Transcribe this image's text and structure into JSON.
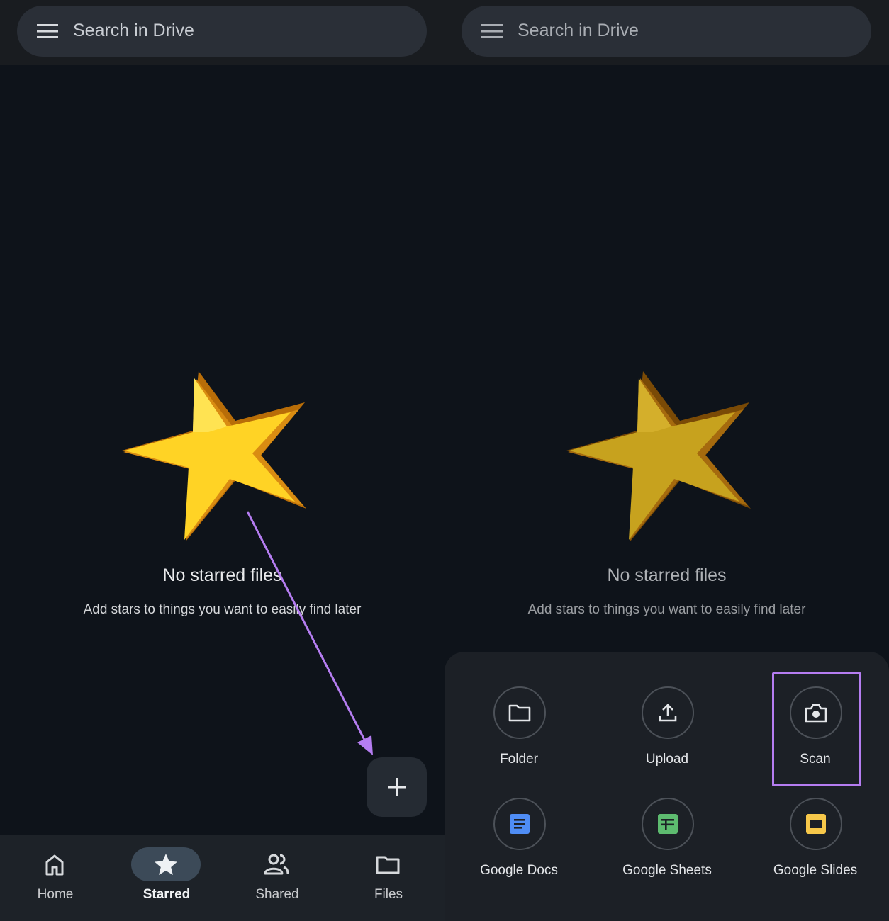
{
  "left_panel": {
    "search": {
      "placeholder": "Search in Drive",
      "icon": "menu-icon"
    },
    "empty_state": {
      "title": "No starred files",
      "subtitle": "Add stars to things you want to easily find later",
      "illustration": "star-illustration"
    },
    "fab": {
      "icon": "plus-icon"
    },
    "bottom_nav": [
      {
        "label": "Home",
        "icon": "home-icon",
        "active": false
      },
      {
        "label": "Starred",
        "icon": "star-icon",
        "active": true
      },
      {
        "label": "Shared",
        "icon": "people-icon",
        "active": false
      },
      {
        "label": "Files",
        "icon": "folder-icon",
        "active": false
      }
    ]
  },
  "right_panel": {
    "search": {
      "placeholder": "Search in Drive",
      "icon": "menu-icon"
    },
    "empty_state": {
      "title": "No starred files",
      "subtitle": "Add stars to things you want to easily find later"
    },
    "create_sheet": {
      "items": [
        {
          "label": "Folder",
          "icon": "folder-icon"
        },
        {
          "label": "Upload",
          "icon": "upload-icon"
        },
        {
          "label": "Scan",
          "icon": "camera-icon",
          "highlighted": true
        },
        {
          "label": "Google Docs",
          "icon": "google-docs-icon"
        },
        {
          "label": "Google Sheets",
          "icon": "google-sheets-icon"
        },
        {
          "label": "Google Slides",
          "icon": "google-slides-icon"
        }
      ]
    }
  },
  "colors": {
    "background": "#0e131a",
    "search_bar": "#2a2f37",
    "annotation": "#b57df1",
    "docs": "#4f8df5",
    "sheets": "#5dbb6f",
    "slides": "#f7c84a",
    "star": "#ffd325"
  }
}
